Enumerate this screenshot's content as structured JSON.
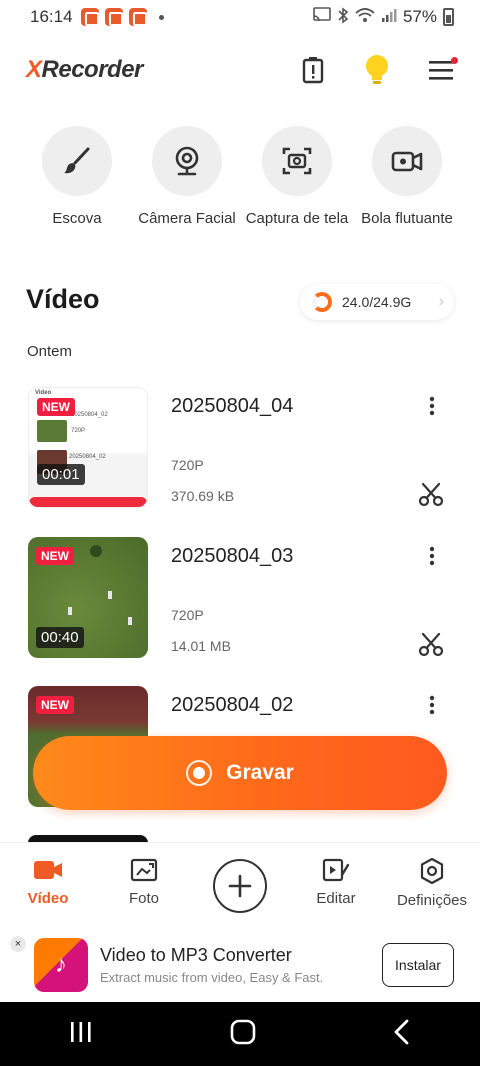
{
  "status_bar": {
    "time": "16:14",
    "battery": "57%"
  },
  "header": {
    "logo_prefix": "X",
    "logo_rest": "Recorder"
  },
  "tools": [
    {
      "label": "Escova",
      "icon": "brush-icon"
    },
    {
      "label": "Câmera Facial",
      "icon": "webcam-icon"
    },
    {
      "label": "Captura de tela",
      "icon": "screenshot-icon"
    },
    {
      "label": "Bola flutuante",
      "icon": "floating-ball-icon"
    }
  ],
  "section": {
    "title": "Vídeo",
    "storage": "24.0/24.9G",
    "date_group": "Ontem"
  },
  "videos": [
    {
      "name": "20250804_04",
      "resolution": "720P",
      "size": "370.69 kB",
      "duration": "00:01",
      "badge": "NEW"
    },
    {
      "name": "20250804_03",
      "resolution": "720P",
      "size": "14.01 MB",
      "duration": "00:40",
      "badge": "NEW"
    },
    {
      "name": "20250804_02",
      "badge": "NEW"
    }
  ],
  "thumb_mini": {
    "header": "Video",
    "row_a": "20250804_02",
    "row_b": "720P",
    "row_c": "20250804_02"
  },
  "record_button": {
    "label": "Gravar"
  },
  "bottom_nav": [
    {
      "label": "Vídeo",
      "active": true
    },
    {
      "label": "Foto",
      "active": false
    },
    {
      "label": "",
      "active": false
    },
    {
      "label": "Editar",
      "active": false
    },
    {
      "label": "Definições",
      "active": false
    }
  ],
  "ad": {
    "close": "×",
    "title": "Video to MP3 Converter",
    "subtitle": "Extract music from video, Easy & Fast.",
    "button": "Instalar"
  },
  "colors": {
    "accent": "#f05a24",
    "badge": "#ee1f3f"
  }
}
